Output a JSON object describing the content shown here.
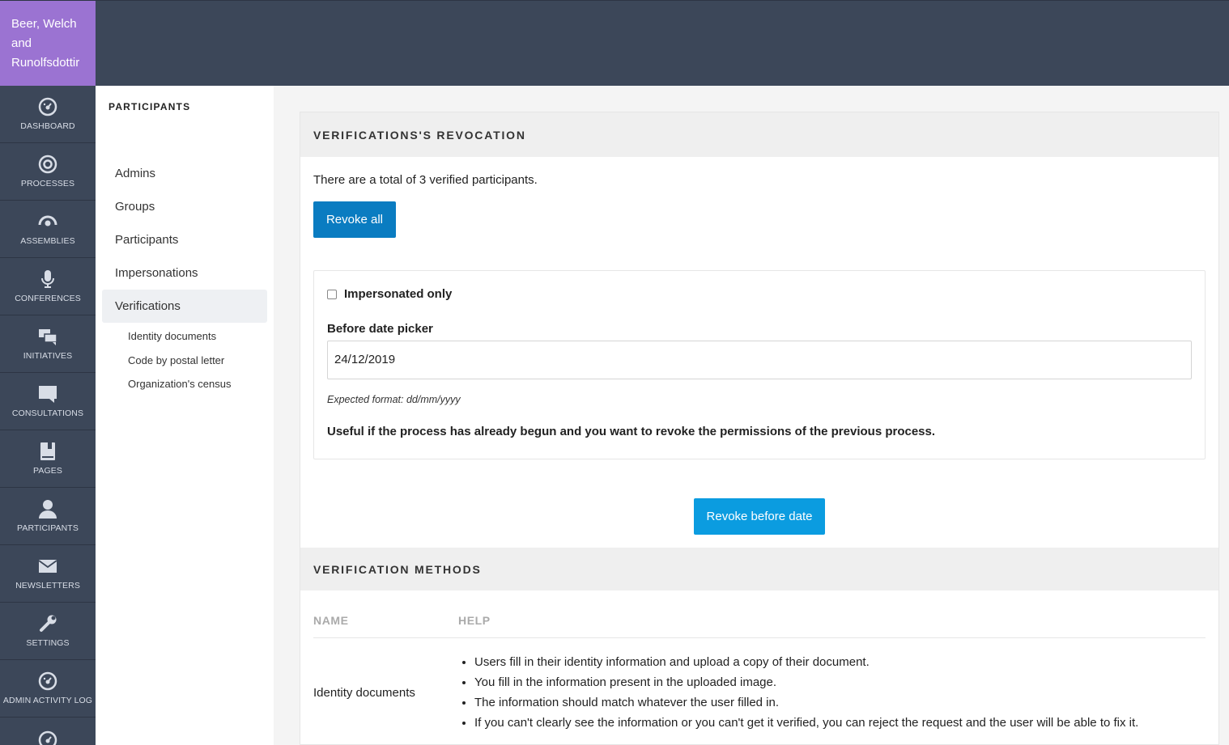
{
  "organization": {
    "name_line1": "Beer, Welch",
    "name_line2": "and",
    "name_line3": "Runolfsdottir"
  },
  "main_nav": [
    {
      "label": "DASHBOARD",
      "icon": "dashboard-icon"
    },
    {
      "label": "PROCESSES",
      "icon": "processes-icon"
    },
    {
      "label": "ASSEMBLIES",
      "icon": "assemblies-icon"
    },
    {
      "label": "CONFERENCES",
      "icon": "microphone-icon"
    },
    {
      "label": "INITIATIVES",
      "icon": "initiatives-icon"
    },
    {
      "label": "CONSULTATIONS",
      "icon": "speech-bubble-icon"
    },
    {
      "label": "PAGES",
      "icon": "book-icon"
    },
    {
      "label": "PARTICIPANTS",
      "icon": "person-icon"
    },
    {
      "label": "NEWSLETTERS",
      "icon": "envelope-icon"
    },
    {
      "label": "SETTINGS",
      "icon": "wrench-icon"
    },
    {
      "label": "ADMIN ACTIVITY LOG",
      "icon": "dashboard-icon"
    }
  ],
  "sub_nav": {
    "title": "PARTICIPANTS",
    "items": [
      "Admins",
      "Groups",
      "Participants",
      "Impersonations",
      "Verifications"
    ],
    "active": "Verifications",
    "sub_items": [
      "Identity documents",
      "Code by postal letter",
      "Organization's census"
    ]
  },
  "revocation": {
    "title": "VERIFICATIONS'S REVOCATION",
    "total_text": "There are a total of 3 verified participants.",
    "revoke_all_label": "Revoke all",
    "impersonated_label": "Impersonated only",
    "impersonated_checked": false,
    "date_label": "Before date picker",
    "date_value": "24/12/2019",
    "date_help": "Expected format: dd/mm/yyyy",
    "useful_text": "Useful if the process has already begun and you want to revoke the permissions of the previous process.",
    "revoke_before_label": "Revoke before date"
  },
  "methods": {
    "title": "VERIFICATION METHODS",
    "col_name": "NAME",
    "col_help": "HELP",
    "rows": [
      {
        "name": "Identity documents",
        "help": [
          "Users fill in their identity information and upload a copy of their document.",
          "You fill in the information present in the uploaded image.",
          "The information should match whatever the user filled in.",
          "If you can't clearly see the information or you can't get it verified, you can reject the request and the user will be able to fix it."
        ]
      }
    ]
  },
  "colors": {
    "org_bg": "#9b73d2",
    "nav_bg": "#3c4759",
    "primary_btn": "#0a7cc1",
    "secondary_btn": "#0b9ce0"
  }
}
